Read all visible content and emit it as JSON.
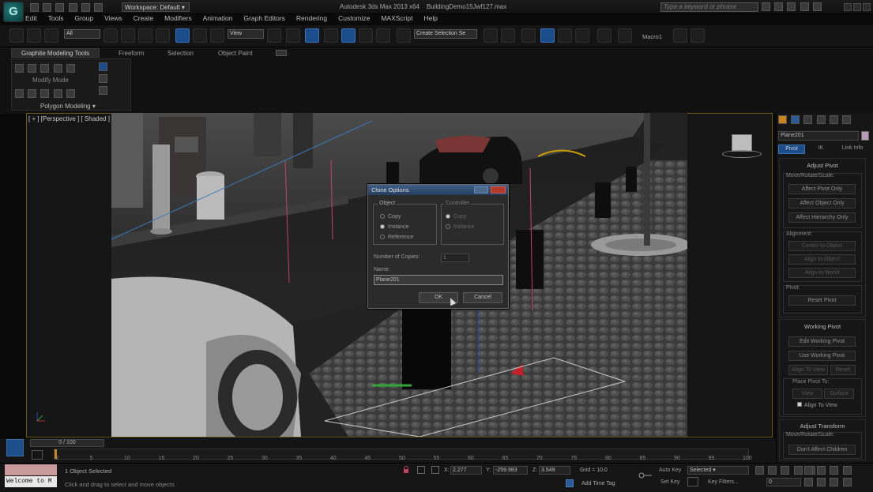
{
  "app": {
    "title": "Autodesk 3ds Max 2013 x64",
    "file": "BuildingDemo15Jwf127.max",
    "logo": "3ds Max logo",
    "workspace": "Workspace: Default",
    "search_placeholder": "Type a keyword or phrase"
  },
  "menu": [
    "Edit",
    "Tools",
    "Group",
    "Views",
    "Create",
    "Modifiers",
    "Animation",
    "Graph Editors",
    "Rendering",
    "Customize",
    "MAXScript",
    "Help"
  ],
  "toolbar": {
    "filter": "All",
    "ref_coord": "View",
    "selection_set": "Create Selection Se",
    "macro": "Macro1"
  },
  "ribbon": {
    "tabs": [
      "Graphite Modeling Tools",
      "Freeform",
      "Selection",
      "Object Paint"
    ],
    "mode": "Modify Mode",
    "panel": "Polygon Modeling ▾"
  },
  "viewport": {
    "label": "[ + ] [Perspective ] [ Shaded ]"
  },
  "command_panel": {
    "object_name": "Plane201",
    "tabs": [
      "Pivot",
      "IK",
      "Link Info"
    ],
    "adjust_pivot": {
      "title": "Adjust Pivot",
      "group1": "Move/Rotate/Scale:",
      "btns1": [
        "Affect Pivot Only",
        "Affect Object Only",
        "Affect Hierarchy Only"
      ],
      "group2": "Alignment:",
      "btns2": [
        "Center to Object",
        "Align to Object",
        "Align to World"
      ],
      "group3": "Pivot:",
      "btns3": [
        "Reset Pivot"
      ]
    },
    "working_pivot": {
      "title": "Working Pivot",
      "btns": [
        "Edit Working Pivot",
        "Use Working Pivot"
      ],
      "align_view": "Align To View",
      "reset": "Reset",
      "place_label": "Place Pivot To:",
      "view": "View",
      "surface": "Surface",
      "align_to_view_cb": "Align To View"
    },
    "adjust_transform": {
      "title": "Adjust Transform",
      "group": "Move/Rotate/Scale:",
      "btn": "Don't Affect Children"
    }
  },
  "dialog": {
    "title": "Clone Options",
    "object_label": "Object",
    "object_options": [
      "Copy",
      "Instance",
      "Reference"
    ],
    "object_selected": 1,
    "controller_label": "Controller",
    "controller_options": [
      "Copy",
      "Instance"
    ],
    "controller_selected": 0,
    "copies_label": "Number of Copies:",
    "copies_value": "1",
    "name_label": "Name:",
    "name_value": "Plane201",
    "ok": "OK",
    "cancel": "Cancel"
  },
  "timeline": {
    "frame": "0 / 100",
    "ticks": [
      "0",
      "5",
      "10",
      "15",
      "20",
      "25",
      "30",
      "35",
      "40",
      "45",
      "50",
      "55",
      "60",
      "65",
      "70",
      "75",
      "80",
      "85",
      "90",
      "95",
      "100"
    ]
  },
  "status": {
    "welcome": "Welcome to M",
    "selected": "1 Object Selected",
    "prompt": "Click and drag to select and move objects",
    "x_label": "X:",
    "x": "2.277",
    "y_label": "Y:",
    "y": "-259.983",
    "z_label": "Z:",
    "z": "3.549",
    "grid": "Grid = 10.0",
    "add_time_tag": "Add Time Tag",
    "auto_key": "Auto Key",
    "key_mode": "Selected",
    "set_key": "Set Key",
    "key_filters": "Key Filters...",
    "frame_field": "0"
  }
}
